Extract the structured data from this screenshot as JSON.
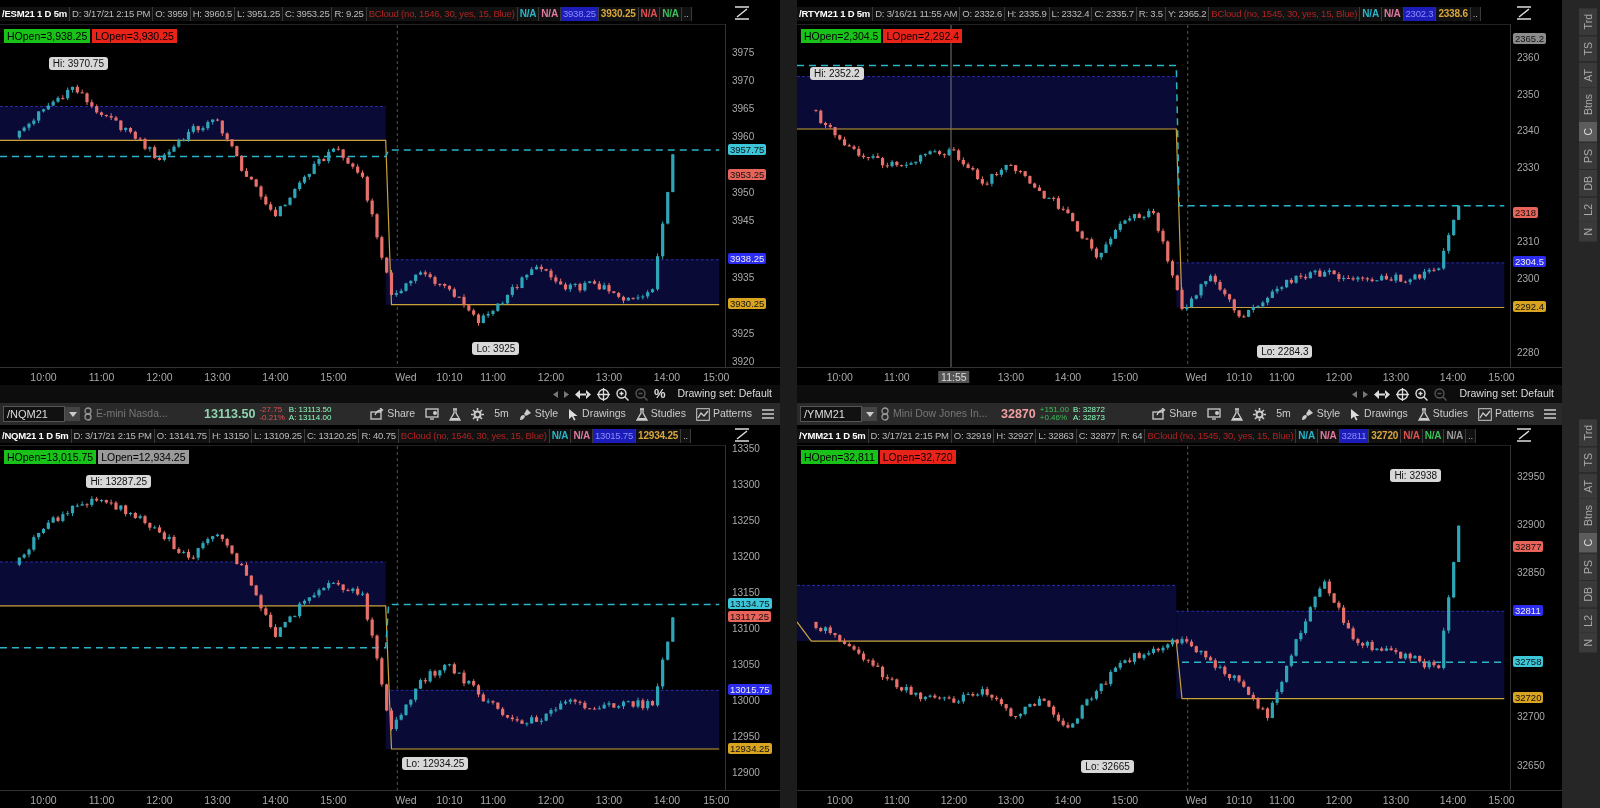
{
  "rows": [
    {
      "panels": [
        {
          "header": [
            {
              "kind": "title",
              "text": "/ESM21 1 D 5m"
            },
            {
              "kind": "field",
              "text": "D: 3/17/21 2:15 PM"
            },
            {
              "kind": "field",
              "text": "O: 3959"
            },
            {
              "kind": "field",
              "text": "H: 3960.5"
            },
            {
              "kind": "field",
              "text": "L: 3951.25"
            },
            {
              "kind": "field",
              "text": "C: 3953.25"
            },
            {
              "kind": "field",
              "text": "R: 9.25"
            },
            {
              "kind": "study",
              "text": "BCloud (no, 1546, 30, yes, 15, Blue)"
            },
            {
              "kind": "value",
              "text": "N/A",
              "color": "#29b6c8"
            },
            {
              "kind": "value",
              "text": "N/A",
              "color": "#e07aa0"
            },
            {
              "kind": "chip",
              "text": "3938.25",
              "color": "#1c1cb8"
            },
            {
              "kind": "value",
              "text": "3930.25",
              "color": "#d8a73a"
            },
            {
              "kind": "value",
              "text": "N/A",
              "color": "#e05050"
            },
            {
              "kind": "value",
              "text": "N/A",
              "color": "#3bbf5a"
            },
            {
              "kind": "more",
              "text": ".."
            }
          ],
          "badges": [
            {
              "text": "HOpen=3,938.25",
              "color": "#19c219"
            },
            {
              "text": "LOpen=3,930.25",
              "color": "#e8231a"
            }
          ],
          "callouts": [
            "Hi: 3970.75",
            "Lo: 3925"
          ],
          "price_axis": [
            "3975",
            "3970",
            "3965",
            "3960",
            "3950",
            "3945",
            "3935",
            "3925",
            "3920"
          ],
          "price_tags": [
            {
              "text": "3957.75",
              "color": "#3bc7d9"
            },
            {
              "text": "3953.25",
              "color": "#e8645a"
            },
            {
              "text": "3938.25",
              "color": "#2c2cf0"
            },
            {
              "text": "3930.25",
              "color": "#d9a520"
            }
          ],
          "time_axis": [
            "10:00",
            "11:00",
            "12:00",
            "13:00",
            "14:00",
            "15:00",
            "Wed",
            "10:10",
            "11:00",
            "12:00",
            "13:00",
            "14:00",
            "15:00"
          ],
          "footer": {
            "controls": [
              {
                "kind": "scroll_left"
              },
              {
                "kind": "scroll_right"
              },
              {
                "kind": "pan"
              },
              {
                "kind": "crosshair"
              },
              {
                "kind": "zoom_in"
              },
              {
                "kind": "zoom_out"
              },
              {
                "kind": "percent",
                "label": "%"
              }
            ],
            "drawing_set": "Drawing set: Default"
          }
        },
        {
          "header": [
            {
              "kind": "title",
              "text": "/RTYM21 1 D 5m"
            },
            {
              "kind": "field",
              "text": "D: 3/16/21 11:55 AM"
            },
            {
              "kind": "field",
              "text": "O: 2332.6"
            },
            {
              "kind": "field",
              "text": "H: 2335.9"
            },
            {
              "kind": "field",
              "text": "L: 2332.4"
            },
            {
              "kind": "field",
              "text": "C: 2335.7"
            },
            {
              "kind": "field",
              "text": "R: 3.5"
            },
            {
              "kind": "field",
              "text": "Y: 2365.2"
            },
            {
              "kind": "study",
              "text": "BCloud (no, 1545, 30, yes, 15, Blue)"
            },
            {
              "kind": "value",
              "text": "N/A",
              "color": "#29b6c8"
            },
            {
              "kind": "value",
              "text": "N/A",
              "color": "#e07aa0"
            },
            {
              "kind": "chip",
              "text": "2302.3",
              "color": "#1c1cb8"
            },
            {
              "kind": "value",
              "text": "2338.6",
              "color": "#d8a73a"
            },
            {
              "kind": "more",
              "text": ".."
            }
          ],
          "badges": [
            {
              "text": "HOpen=2,304.5",
              "color": "#19c219"
            },
            {
              "text": "LOpen=2,292.4",
              "color": "#e8231a"
            }
          ],
          "callouts": [
            "Hi: 2352.2",
            "Lo: 2284.3"
          ],
          "price_axis": [
            "2360",
            "2350",
            "2340",
            "2330",
            "2310",
            "2300",
            "2280"
          ],
          "price_tags": [
            {
              "text": "2365.2",
              "color": "#8c8c8c"
            },
            {
              "text": "2318",
              "color": "#e8645a"
            },
            {
              "text": "2304.5",
              "color": "#2c2cf0"
            },
            {
              "text": "2292.4",
              "color": "#d9a520"
            }
          ],
          "time_axis": [
            "10:00",
            "11:00",
            "11:55",
            "13:00",
            "14:00",
            "15:00",
            "Wed",
            "10:10",
            "11:00",
            "12:00",
            "13:00",
            "14:00",
            "15:00"
          ],
          "footer": {
            "controls": [
              {
                "kind": "scroll_left"
              },
              {
                "kind": "scroll_right"
              },
              {
                "kind": "pan"
              },
              {
                "kind": "crosshair"
              },
              {
                "kind": "zoom_in"
              },
              {
                "kind": "zoom_out"
              }
            ],
            "drawing_set": "Drawing set: Default"
          }
        }
      ],
      "side_tabs": [
        {
          "label": "Trd",
          "selected": false
        },
        {
          "label": "TS",
          "selected": false
        },
        {
          "label": "AT",
          "selected": false
        },
        {
          "label": "Btns",
          "selected": false
        },
        {
          "label": "C",
          "selected": true
        },
        {
          "label": "PS",
          "selected": false
        },
        {
          "label": "DB",
          "selected": false
        },
        {
          "label": "L2",
          "selected": false
        },
        {
          "label": "N",
          "selected": false
        }
      ]
    },
    {
      "panels": [
        {
          "toolbar": {
            "symbol": "/NQM21",
            "description": "E-mini Nasda...",
            "last": "13113.50",
            "last_up": true,
            "change": "-27.75",
            "percent": "-0.21%",
            "change_up": false,
            "bid": "B: 13113.50",
            "ask": "A: 13114.00",
            "buttons": [
              {
                "kind": "share",
                "label": "Share"
              },
              {
                "kind": "alert"
              },
              {
                "kind": "flask"
              },
              {
                "kind": "gear"
              },
              {
                "kind": "text",
                "label": "5m"
              },
              {
                "kind": "style",
                "label": "Style"
              },
              {
                "kind": "drawings",
                "label": "Drawings"
              },
              {
                "kind": "studies",
                "label": "Studies"
              },
              {
                "kind": "patterns",
                "label": "Patterns"
              },
              {
                "kind": "menu"
              }
            ]
          },
          "header": [
            {
              "kind": "title",
              "text": "/NQM21 1 D 5m"
            },
            {
              "kind": "field",
              "text": "D: 3/17/21 2:15 PM"
            },
            {
              "kind": "field",
              "text": "O: 13141.75"
            },
            {
              "kind": "field",
              "text": "H: 13150"
            },
            {
              "kind": "field",
              "text": "L: 13109.25"
            },
            {
              "kind": "field",
              "text": "C: 13120.25"
            },
            {
              "kind": "field",
              "text": "R: 40.75"
            },
            {
              "kind": "study",
              "text": "BCloud (no, 1546, 30, yes, 15, Blue)"
            },
            {
              "kind": "value",
              "text": "N/A",
              "color": "#29b6c8"
            },
            {
              "kind": "value",
              "text": "N/A",
              "color": "#e07aa0"
            },
            {
              "kind": "chip",
              "text": "13015.75",
              "color": "#1c1cb8"
            },
            {
              "kind": "value",
              "text": "12934.25",
              "color": "#d8a73a"
            },
            {
              "kind": "more",
              "text": ".."
            }
          ],
          "badges": [
            {
              "text": "HOpen=13,015.75",
              "color": "#19c219"
            },
            {
              "text": "LOpen=12,934.25",
              "color": "#9a9a9a"
            }
          ],
          "callouts": [
            "Hi: 13287.25",
            "Lo: 12934.25"
          ],
          "price_axis": [
            "13350",
            "13300",
            "13250",
            "13200",
            "13150",
            "13100",
            "13050",
            "13000",
            "12950",
            "12900"
          ],
          "price_tags": [
            {
              "text": "13134.75",
              "color": "#3bc7d9"
            },
            {
              "text": "13117.25",
              "color": "#e8645a"
            },
            {
              "text": "13015.75",
              "color": "#2c2cf0"
            },
            {
              "text": "12934.25",
              "color": "#d9a520"
            }
          ],
          "time_axis": [
            "10:00",
            "11:00",
            "12:00",
            "13:00",
            "14:00",
            "15:00",
            "Wed",
            "10:10",
            "11:00",
            "12:00",
            "13:00",
            "14:00",
            "15:00"
          ]
        },
        {
          "toolbar": {
            "symbol": "/YMM21",
            "description": "Mini Dow Jones In...",
            "last": "32870",
            "last_up": false,
            "change": "+151.00",
            "percent": "+0.46%",
            "change_up": true,
            "bid": "B: 32872",
            "ask": "A: 32873",
            "buttons": [
              {
                "kind": "share",
                "label": "Share"
              },
              {
                "kind": "alert"
              },
              {
                "kind": "flask"
              },
              {
                "kind": "gear"
              },
              {
                "kind": "text",
                "label": "5m"
              },
              {
                "kind": "style",
                "label": "Style"
              },
              {
                "kind": "drawings",
                "label": "Drawings"
              },
              {
                "kind": "studies",
                "label": "Studies"
              },
              {
                "kind": "patterns",
                "label": "Patterns"
              },
              {
                "kind": "menu"
              }
            ]
          },
          "header": [
            {
              "kind": "title",
              "text": "/YMM21 1 D 5m"
            },
            {
              "kind": "field",
              "text": "D: 3/17/21 2:15 PM"
            },
            {
              "kind": "field",
              "text": "O: 32919"
            },
            {
              "kind": "field",
              "text": "H: 32927"
            },
            {
              "kind": "field",
              "text": "L: 32863"
            },
            {
              "kind": "field",
              "text": "C: 32877"
            },
            {
              "kind": "field",
              "text": "R: 64"
            },
            {
              "kind": "study",
              "text": "BCloud (no, 1545, 30, yes, 15, Blue)"
            },
            {
              "kind": "value",
              "text": "N/A",
              "color": "#29b6c8"
            },
            {
              "kind": "value",
              "text": "N/A",
              "color": "#e07aa0"
            },
            {
              "kind": "chip",
              "text": "32811",
              "color": "#1c1cb8"
            },
            {
              "kind": "value",
              "text": "32720",
              "color": "#d8a73a"
            },
            {
              "kind": "value",
              "text": "N/A",
              "color": "#e05050"
            },
            {
              "kind": "value",
              "text": "N/A",
              "color": "#3bbf5a"
            },
            {
              "kind": "value",
              "text": "N/A",
              "color": "#9a9a9a"
            },
            {
              "kind": "more",
              "text": ".."
            }
          ],
          "badges": [
            {
              "text": "HOpen=32,811",
              "color": "#19c219"
            },
            {
              "text": "LOpen=32,720",
              "color": "#e8231a"
            }
          ],
          "callouts": [
            "Hi: 32938",
            "Lo: 32665"
          ],
          "price_axis": [
            "32950",
            "32900",
            "32850",
            "32700",
            "32650"
          ],
          "price_tags": [
            {
              "text": "32877",
              "color": "#e8645a"
            },
            {
              "text": "32811",
              "color": "#2c2cf0"
            },
            {
              "text": "32758",
              "color": "#3bc7d9"
            },
            {
              "text": "32720",
              "color": "#d9a520"
            }
          ],
          "time_axis": [
            "10:00",
            "11:00",
            "12:00",
            "13:00",
            "14:00",
            "15:00",
            "Wed",
            "10:10",
            "11:00",
            "12:00",
            "13:00",
            "14:00",
            "15:00"
          ]
        }
      ],
      "side_tabs": [
        {
          "label": "Trd",
          "selected": false
        },
        {
          "label": "TS",
          "selected": false
        },
        {
          "label": "AT",
          "selected": false
        },
        {
          "label": "Btns",
          "selected": false
        },
        {
          "label": "C",
          "selected": true
        },
        {
          "label": "PS",
          "selected": false
        },
        {
          "label": "DB",
          "selected": false
        },
        {
          "label": "L2",
          "selected": false
        },
        {
          "label": "N",
          "selected": false
        }
      ]
    }
  ]
}
